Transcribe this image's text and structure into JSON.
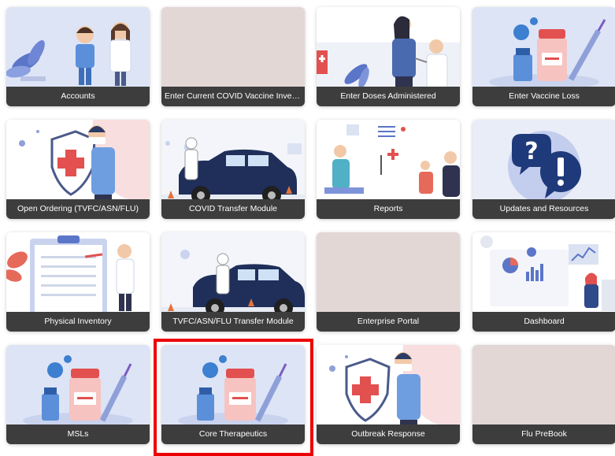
{
  "tiles": [
    {
      "label": "Accounts"
    },
    {
      "label": "Enter Current COVID Vaccine Inven..."
    },
    {
      "label": "Enter Doses Administered"
    },
    {
      "label": "Enter Vaccine Loss"
    },
    {
      "label": "Open Ordering (TVFC/ASN/FLU)"
    },
    {
      "label": "COVID Transfer Module"
    },
    {
      "label": "Reports"
    },
    {
      "label": "Updates and Resources"
    },
    {
      "label": "Physical Inventory"
    },
    {
      "label": "TVFC/ASN/FLU Transfer Module"
    },
    {
      "label": "Enterprise Portal"
    },
    {
      "label": "Dashboard"
    },
    {
      "label": "MSLs"
    },
    {
      "label": "Core Therapeutics"
    },
    {
      "label": "Outbreak Response"
    },
    {
      "label": "Flu PreBook"
    }
  ],
  "selected_tile": "Core Therapeutics",
  "colors": {
    "label_bar": "#3d3d3d",
    "selection_border": "#ee0000",
    "placeholder": "#e3d7d6",
    "tile_background": "#dde4f6"
  }
}
